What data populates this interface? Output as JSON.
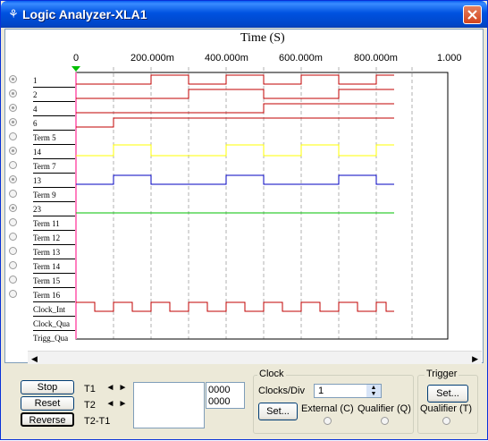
{
  "window": {
    "title": "Logic Analyzer-XLA1"
  },
  "plot": {
    "axis_title": "Time (S)",
    "ticks": [
      "0",
      "200.000m",
      "400.000m",
      "600.000m",
      "800.000m",
      "1.000"
    ],
    "terminals": [
      "1",
      "2",
      "4",
      "6",
      "Term 5",
      "14",
      "Term 7",
      "13",
      "Term 9",
      "23",
      "Term 11",
      "Term 12",
      "Term 13",
      "Term 14",
      "Term 15",
      "Term 16",
      "Clock_Int",
      "Clock_Qua",
      "Trigg_Qua"
    ],
    "colors": {
      "red": "#c00000",
      "yellow": "#ffff00",
      "blue": "#0000c0",
      "green": "#00c000",
      "pink": "#ff7fbf",
      "marker": "#00c000"
    }
  },
  "controls": {
    "stop": "Stop",
    "reset": "Reset",
    "reverse": "Reverse",
    "t1_label": "T1",
    "t2_label": "T2",
    "t2t1_label": "T2-T1",
    "t1_value": "0000",
    "t2_value": "0000"
  },
  "clock": {
    "group_title": "Clock",
    "clocks_per_div_label": "Clocks/Div",
    "clocks_per_div_value": "1",
    "set_label": "Set...",
    "external_label": "External (C)",
    "qualifier_label": "Qualifier (Q)"
  },
  "trigger": {
    "group_title": "Trigger",
    "set_label": "Set...",
    "qualifier_label": "Qualifier (T)"
  }
}
